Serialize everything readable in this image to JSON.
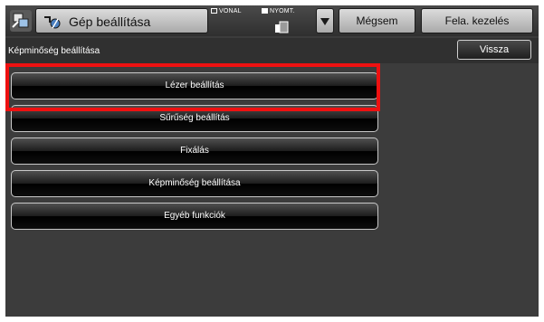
{
  "header": {
    "title": "Gép beállítása",
    "mode_line": "VONAL",
    "mode_print": "NYOMT.",
    "cancel_label": "Mégsem",
    "job_release_label": "Fela. kezelés"
  },
  "subheader": {
    "title": "Képminőség beállítása",
    "back_label": "Vissza"
  },
  "menu": {
    "items": [
      {
        "label": "Lézer beállítás",
        "selected": true
      },
      {
        "label": "Sűrűség beállítás"
      },
      {
        "label": "Fixálás"
      },
      {
        "label": "Képminőség beállítása"
      },
      {
        "label": "Egyéb funkciók"
      }
    ]
  },
  "colors": {
    "highlight": "#ee1111",
    "background": "#3c3c3c"
  }
}
